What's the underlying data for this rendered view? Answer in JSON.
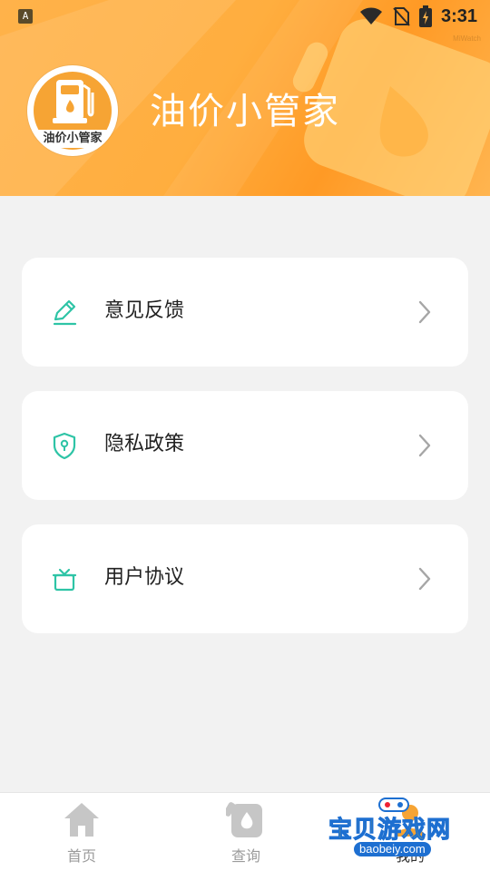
{
  "status_bar": {
    "app_icon": "A",
    "time": "3:31",
    "watermark": "MiWatch",
    "icons": [
      "wifi-icon",
      "no-sim-icon",
      "battery-charging-icon"
    ]
  },
  "header": {
    "title": "油价小管家",
    "logo_text": "油价小管家",
    "gradient": [
      "#ffb24a",
      "#ff9a25"
    ]
  },
  "menu": {
    "items": [
      {
        "label": "意见反馈",
        "icon": "edit-icon"
      },
      {
        "label": "隐私政策",
        "icon": "shield-icon"
      },
      {
        "label": "用户协议",
        "icon": "gift-box-icon"
      }
    ],
    "icon_color": "#2ec4a6"
  },
  "bottom_nav": {
    "items": [
      {
        "label": "首页",
        "icon": "home-icon"
      },
      {
        "label": "查询",
        "icon": "fuel-drop-icon"
      },
      {
        "label": "我的",
        "icon": "profile-icon"
      }
    ]
  },
  "watermark": {
    "text": "宝贝游戏网",
    "url": "baobeiy.com"
  }
}
